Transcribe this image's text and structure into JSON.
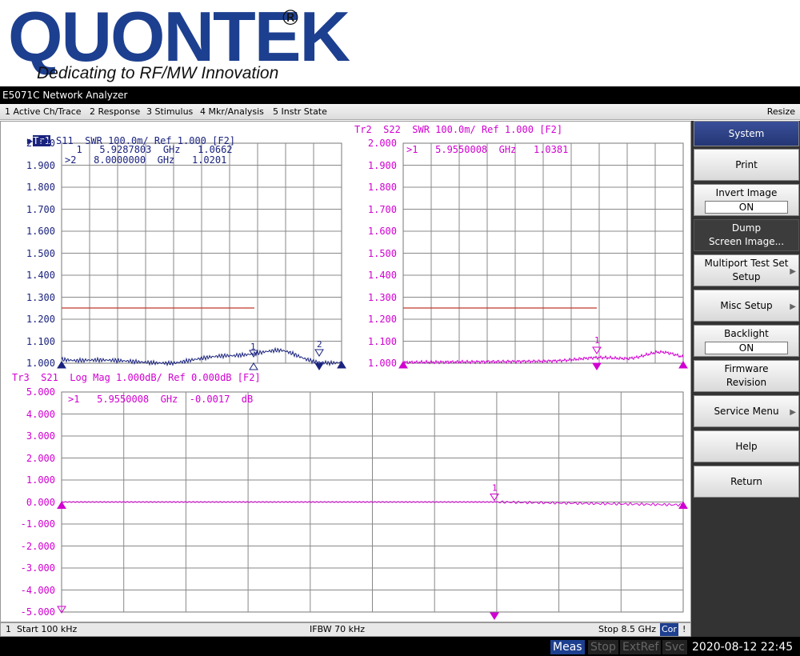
{
  "logo": {
    "word": "QUONTEK",
    "registered": "®",
    "tagline": "Dedicating to RF/MW Innovation"
  },
  "window": {
    "title": "E5071C Network Analyzer"
  },
  "menu": {
    "items": [
      "1 Active Ch/Trace",
      "2 Response",
      "3 Stimulus",
      "4 Mkr/Analysis",
      "5 Instr State"
    ],
    "resize": "Resize"
  },
  "traces": {
    "tr1": {
      "id": "Tr1",
      "header": " S11  SWR 100.0m/ Ref 1.000 [F2]",
      "markers": [
        "  1   5.9287803  GHz   1.0662",
        ">2   8.0000000  GHz   1.0201"
      ],
      "y_ticks": [
        "2.000",
        "1.900",
        "1.800",
        "1.700",
        "1.600",
        "1.500",
        "1.400",
        "1.300",
        "1.200",
        "1.100",
        "1.000"
      ]
    },
    "tr2": {
      "header": "Tr2  S22  SWR 100.0m/ Ref 1.000 [F2]",
      "markers": [
        ">1   5.9550008  GHz   1.0381"
      ],
      "y_ticks": [
        "2.000",
        "1.900",
        "1.800",
        "1.700",
        "1.600",
        "1.500",
        "1.400",
        "1.300",
        "1.200",
        "1.100",
        "1.000"
      ]
    },
    "tr3": {
      "header": "Tr3  S21  Log Mag 1.000dB/ Ref 0.000dB [F2]",
      "markers": [
        ">1   5.9550008  GHz  -0.0017  dB"
      ],
      "y_ticks": [
        "5.000",
        "4.000",
        "3.000",
        "2.000",
        "1.000",
        "0.000",
        "-1.000",
        "-2.000",
        "-3.000",
        "-4.000",
        "-5.000"
      ]
    }
  },
  "marker_labels": {
    "m1": "1",
    "m2": "2"
  },
  "status": {
    "channel": "1",
    "start": "Start 100 kHz",
    "ifbw": "IFBW 70 kHz",
    "stop": "Stop 8.5 GHz",
    "cor": "Cor",
    "bang": "!"
  },
  "bottom": {
    "meas": "Meas",
    "stop": "Stop",
    "extref": "ExtRef",
    "svc": "Svc",
    "datetime": "2020-08-12 22:45"
  },
  "softkeys": {
    "title": "System",
    "print": "Print",
    "invert_image": "Invert Image",
    "invert_value": "ON",
    "dump_line1": "Dump",
    "dump_line2": "Screen Image...",
    "multiport_line1": "Multiport Test Set",
    "multiport_line2": "Setup",
    "misc": "Misc Setup",
    "backlight": "Backlight",
    "backlight_value": "ON",
    "firmware_line1": "Firmware",
    "firmware_line2": "Revision",
    "service": "Service Menu",
    "help": "Help",
    "return": "Return"
  },
  "colors": {
    "trace_blue": "#1a237e",
    "trace_magenta": "#d100d1",
    "limit_red": "#c0392b",
    "accent": "#1d3f8f"
  }
}
